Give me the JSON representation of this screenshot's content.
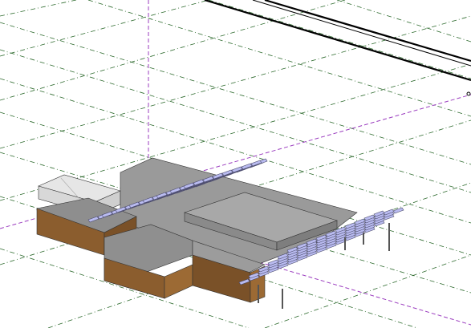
{
  "viewport": {
    "background": "#ffffff",
    "grid_color": "#2e6b2e",
    "axis_color": "#9b3dbf",
    "wall_color": "#8b5d2e",
    "roof_color": "#9a9a9a",
    "panel_color": "#b9bbf0",
    "panel_frame_color": "#4a4a6a",
    "utility_line_color": "#000000",
    "model": "building-with-solar-canopies"
  }
}
